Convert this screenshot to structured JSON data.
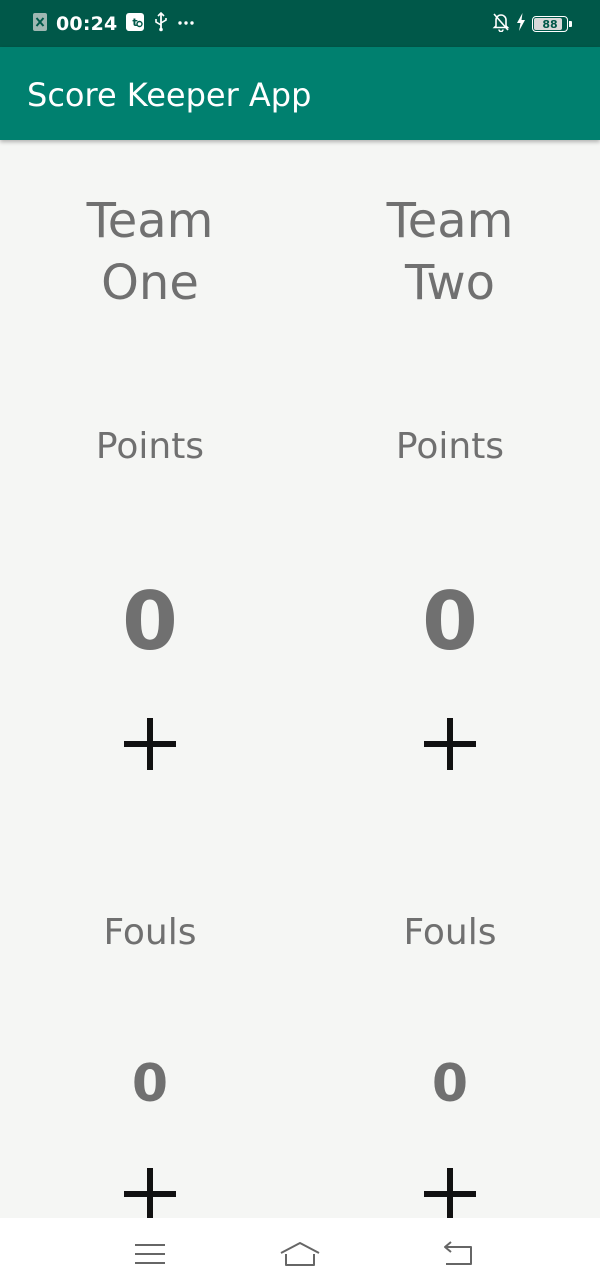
{
  "status_bar": {
    "time": "00:24",
    "battery_level": "88",
    "battery_fraction": 0.88,
    "icons": [
      "excel-notification-icon",
      "vpn-key-icon",
      "usb-icon",
      "more-dots-icon",
      "bell-off-icon",
      "charging-bolt-icon",
      "battery-icon"
    ]
  },
  "app_bar": {
    "title": "Score Keeper App"
  },
  "teams": [
    {
      "name": "Team One",
      "points_label": "Points",
      "points": "0",
      "fouls_label": "Fouls",
      "fouls": "0"
    },
    {
      "name": "Team Two",
      "points_label": "Points",
      "points": "0",
      "fouls_label": "Fouls",
      "fouls": "0"
    }
  ],
  "nav_bar": {
    "icons": [
      "menu-icon",
      "home-icon",
      "back-icon"
    ]
  },
  "colors": {
    "status_bar": "#005849",
    "app_bar": "#00806f",
    "background": "#f5f6f4",
    "text_gray": "#707070",
    "plus": "#111111"
  }
}
